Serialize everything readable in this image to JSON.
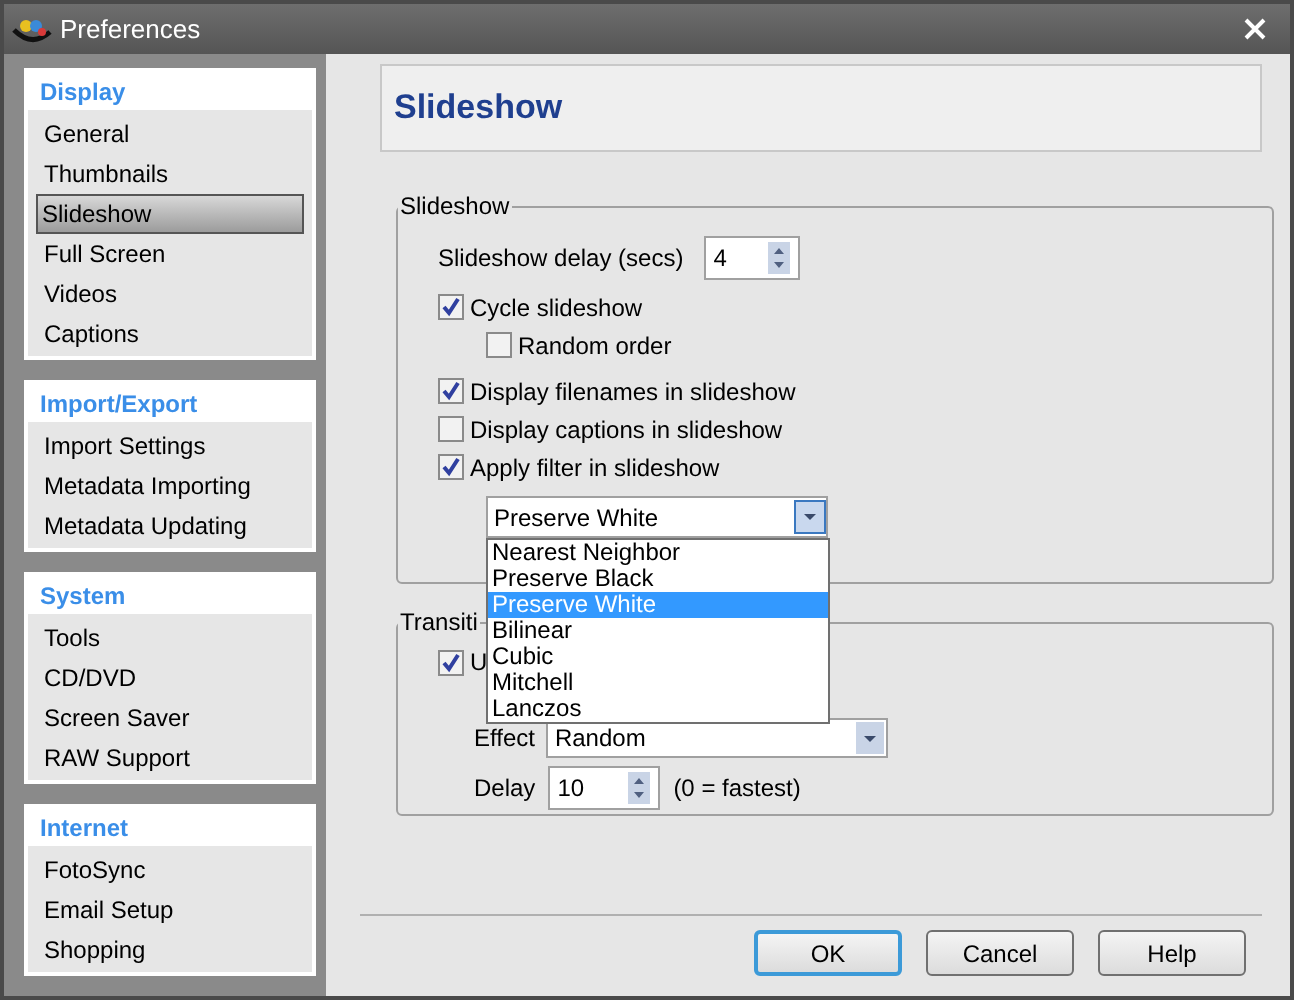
{
  "window": {
    "title": "Preferences"
  },
  "sidebar": [
    {
      "heading": "Display",
      "items": [
        {
          "label": "General",
          "selected": false
        },
        {
          "label": "Thumbnails",
          "selected": false
        },
        {
          "label": "Slideshow",
          "selected": true
        },
        {
          "label": "Full Screen",
          "selected": false
        },
        {
          "label": "Videos",
          "selected": false
        },
        {
          "label": "Captions",
          "selected": false
        }
      ]
    },
    {
      "heading": "Import/Export",
      "items": [
        {
          "label": "Import Settings",
          "selected": false
        },
        {
          "label": "Metadata Importing",
          "selected": false
        },
        {
          "label": "Metadata Updating",
          "selected": false
        }
      ]
    },
    {
      "heading": "System",
      "items": [
        {
          "label": "Tools",
          "selected": false
        },
        {
          "label": "CD/DVD",
          "selected": false
        },
        {
          "label": "Screen Saver",
          "selected": false
        },
        {
          "label": "RAW Support",
          "selected": false
        }
      ]
    },
    {
      "heading": "Internet",
      "items": [
        {
          "label": "FotoSync",
          "selected": false
        },
        {
          "label": "Email Setup",
          "selected": false
        },
        {
          "label": "Shopping",
          "selected": false
        }
      ]
    }
  ],
  "page_title": "Slideshow",
  "slideshow_group": {
    "title": "Slideshow",
    "delay_label": "Slideshow delay (secs)",
    "delay_value": "4",
    "options": [
      {
        "label": "Cycle slideshow",
        "checked": true,
        "children": [
          {
            "label": "Random order",
            "checked": false
          }
        ]
      },
      {
        "label": "Display filenames in slideshow",
        "checked": true
      },
      {
        "label": "Display captions in slideshow",
        "checked": false
      },
      {
        "label": "Apply filter in slideshow",
        "checked": true
      }
    ],
    "filter": {
      "value": "Preserve White",
      "expanded": true,
      "options": [
        {
          "label": "Nearest Neighbor",
          "selected": false
        },
        {
          "label": "Preserve Black",
          "selected": false
        },
        {
          "label": "Preserve White",
          "selected": true
        },
        {
          "label": "Bilinear",
          "selected": false
        },
        {
          "label": "Cubic",
          "selected": false
        },
        {
          "label": "Mitchell",
          "selected": false
        },
        {
          "label": "Lanczos",
          "selected": false
        }
      ]
    }
  },
  "transitions_group": {
    "title": "Transiti",
    "checkbox": {
      "label": "U",
      "checked": true
    },
    "effect_label": "Effect",
    "effect_value": "Random",
    "delay_label": "Delay",
    "delay_value": "10",
    "delay_hint": "(0 = fastest)"
  },
  "buttons": [
    {
      "label": "OK",
      "default": true
    },
    {
      "label": "Cancel",
      "default": false
    },
    {
      "label": "Help",
      "default": false
    }
  ]
}
